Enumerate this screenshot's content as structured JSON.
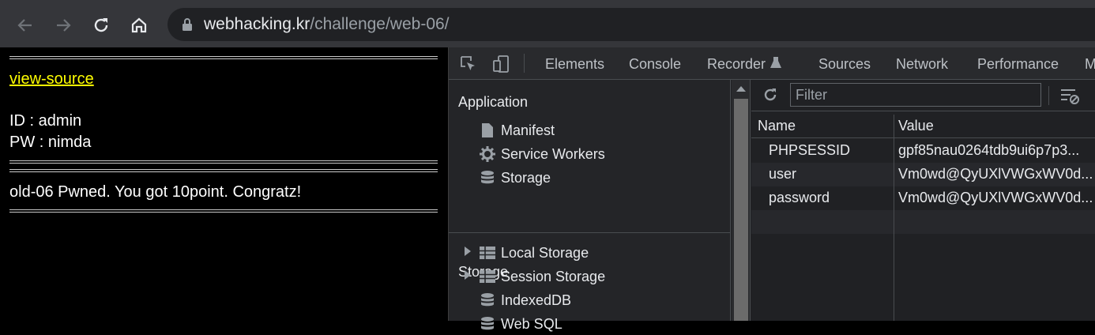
{
  "browser": {
    "url_host": "webhacking.kr",
    "url_path": "/challenge/web-06/",
    "icons": [
      "back-arrow-icon",
      "forward-arrow-icon",
      "reload-icon",
      "home-icon",
      "lock-icon"
    ]
  },
  "page": {
    "link_label": "view-source",
    "id_line": "ID : admin",
    "pw_line": "PW : nimda",
    "message": "old-06 Pwned. You got 10point. Congratz!",
    "colors": {
      "link": "#ffff00",
      "background": "#000000",
      "text": "#ffffff"
    }
  },
  "devtools": {
    "tabs": [
      "Elements",
      "Console",
      "Recorder",
      "Sources",
      "Network",
      "Performance",
      "M"
    ],
    "application": {
      "title": "Application",
      "items": [
        {
          "label": "Manifest",
          "icon": "file-icon"
        },
        {
          "label": "Service Workers",
          "icon": "gear-icon"
        },
        {
          "label": "Storage",
          "icon": "database-icon"
        }
      ]
    },
    "storage": {
      "title": "Storage",
      "items": [
        {
          "label": "Local Storage",
          "icon": "grid-icon"
        },
        {
          "label": "Session Storage",
          "icon": "grid-icon"
        },
        {
          "label": "IndexedDB",
          "icon": "database-icon"
        },
        {
          "label": "Web SQL",
          "icon": "database-icon"
        }
      ]
    },
    "cookies": {
      "filter_placeholder": "Filter",
      "columns": [
        "Name",
        "Value"
      ],
      "rows": [
        {
          "name": "PHPSESSID",
          "value": "gpf85nau0264tdb9ui6p7p3..."
        },
        {
          "name": "user",
          "value": "Vm0wd@QyUXlVWGxWV0d..."
        },
        {
          "name": "password",
          "value": "Vm0wd@QyUXlVWGxWV0d..."
        }
      ]
    }
  }
}
